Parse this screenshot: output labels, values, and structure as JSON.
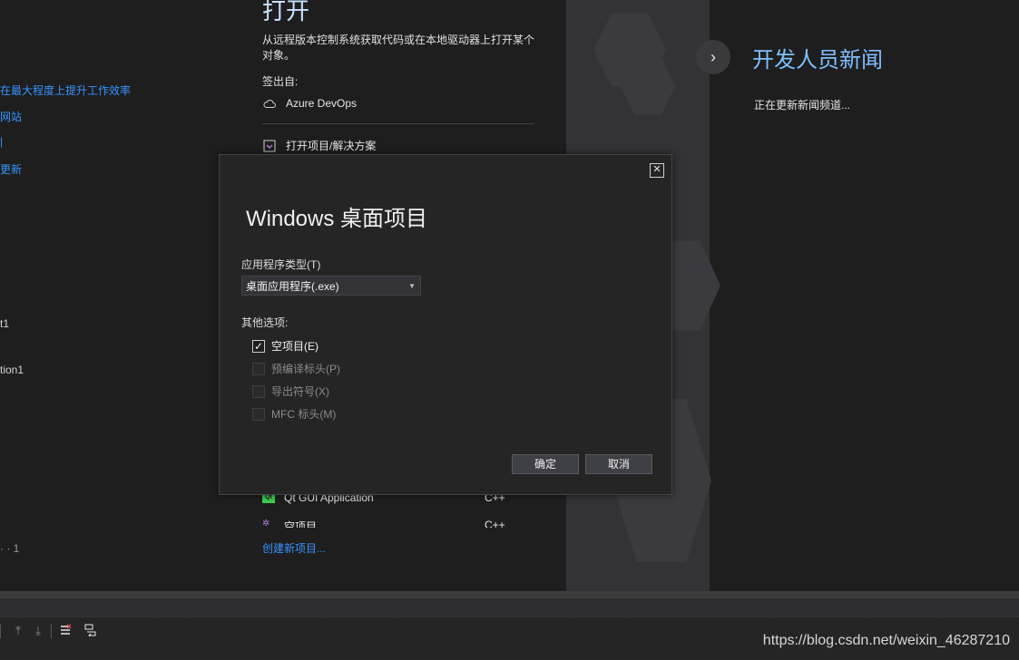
{
  "left_column": {
    "items": [
      {
        "text": "在最大程度上提升工作效率",
        "type": "link"
      },
      {
        "text": "网站",
        "type": "link"
      },
      {
        "text": "|",
        "type": "link"
      },
      {
        "text": "更新",
        "type": "link"
      },
      {
        "text": "t1",
        "type": "text"
      },
      {
        "text": "tion1",
        "type": "text"
      },
      {
        "text": "· · 1",
        "type": "text"
      }
    ]
  },
  "open_section": {
    "title": "打开",
    "description": "从远程版本控制系统获取代码或在本地驱动器上打开某个对象。",
    "checkout_label": "签出自:",
    "azure_label": "Azure DevOps",
    "open_project_label": "打开项目/解决方案"
  },
  "templates": [
    {
      "icon": "Qt",
      "name": "Qt GUI Application",
      "lang": "C++"
    },
    {
      "icon": "cpp",
      "name": "空项目",
      "lang": "C++"
    }
  ],
  "create_new_project": "创建新项目...",
  "news": {
    "title": "开发人员新闻",
    "status": "正在更新新闻频道..."
  },
  "dialog": {
    "title": "Windows 桌面项目",
    "app_type_label": "应用程序类型(T)",
    "app_type_value": "桌面应用程序(.exe)",
    "other_options_label": "其他选项:",
    "options": [
      {
        "label": "空项目(E)",
        "checked": true,
        "enabled": true
      },
      {
        "label": "预编译标头(P)",
        "checked": false,
        "enabled": false
      },
      {
        "label": "导出符号(X)",
        "checked": false,
        "enabled": false
      },
      {
        "label": "MFC 标头(M)",
        "checked": false,
        "enabled": false
      }
    ],
    "ok_label": "确定",
    "cancel_label": "取消"
  },
  "watermark": "https://blog.csdn.net/weixin_46287210",
  "colors": {
    "accent": "#3794ff",
    "background": "#1e1e1e",
    "dialog_bg": "#252526"
  }
}
